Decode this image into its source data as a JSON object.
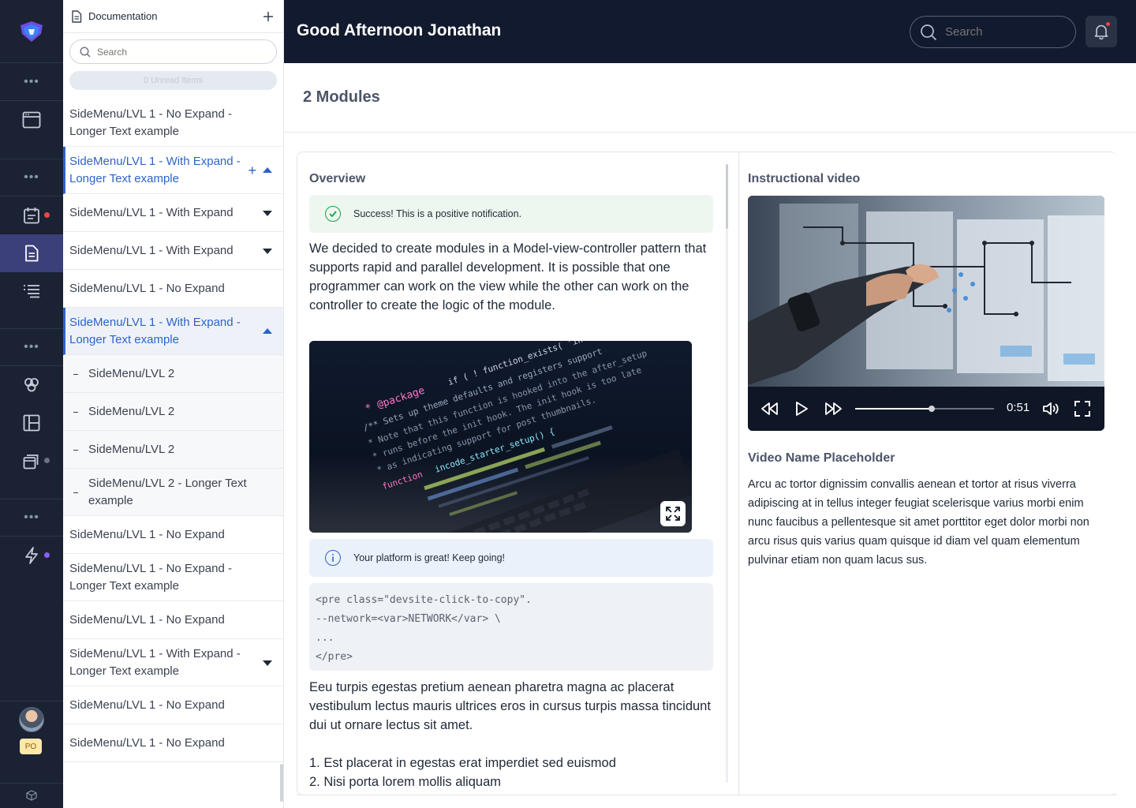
{
  "sidemenu": {
    "title": "Documentation",
    "search_placeholder": "Search",
    "unread": "0 Unread Items",
    "items": [
      {
        "label": "SideMenu/LVL 1 - No Expand - Longer Text example"
      },
      {
        "label": "SideMenu/LVL 1 - With Expand - Longer Text example"
      },
      {
        "label": "SideMenu/LVL 1 - With Expand"
      },
      {
        "label": "SideMenu/LVL 1 - With Expand"
      },
      {
        "label": "SideMenu/LVL 1 - No Expand"
      },
      {
        "label": "SideMenu/LVL 1 - With Expand - Longer Text example"
      },
      {
        "label": "SideMenu/LVL 2"
      },
      {
        "label": "SideMenu/LVL 2"
      },
      {
        "label": "SideMenu/LVL 2"
      },
      {
        "label": "SideMenu/LVL 2 - Longer Text example"
      },
      {
        "label": "SideMenu/LVL 1 - No Expand"
      },
      {
        "label": "SideMenu/LVL 1 - No Expand - Longer Text example"
      },
      {
        "label": "SideMenu/LVL 1 - No Expand"
      },
      {
        "label": "SideMenu/LVL 1 - With Expand - Longer Text example"
      },
      {
        "label": "SideMenu/LVL 1 - No Expand"
      },
      {
        "label": "SideMenu/LVL 1 - No Expand"
      }
    ]
  },
  "rail": {
    "user_badge": "PO",
    "icons": [
      "more-icon",
      "window-icon",
      "more-icon",
      "calendar-icon",
      "document-icon",
      "list-icon",
      "more-icon",
      "hexagons-icon",
      "layout-icon",
      "stack-icon",
      "more-icon",
      "bolt-icon",
      "cube-icon"
    ]
  },
  "topbar": {
    "greeting": "Good Afternoon Jonathan",
    "search_placeholder": "Search"
  },
  "page": {
    "title": "2 Modules"
  },
  "overview": {
    "heading": "Overview",
    "success_note": "Success! This is a positive notification.",
    "para1": "We decided to create modules in a Model-view-controller pattern that supports rapid and parallel development. It is possible that one programmer can work on the view while the other can work on the controller to create the logic of the module.",
    "info_note": "Your platform is great! Keep going!",
    "code": "<pre class=\"devsite-click-to-copy\".\n--network=<var>NETWORK</var> \\\n...\n</pre>",
    "para2": "Eeu turpis egestas pretium aenean pharetra magna ac placerat vestibulum lectus mauris ultrices eros in cursus turpis massa tincidunt dui ut ornare lectus sit amet.",
    "list": [
      "1. Est placerat in egestas erat imperdiet sed euismod",
      "2. Nisi porta lorem mollis aliquam"
    ]
  },
  "video": {
    "heading": "Instructional video",
    "time": "0:51",
    "progress": 0.55,
    "name": "Video Name Placeholder",
    "description": "Arcu ac tortor dignissim convallis aenean et tortor at risus viverra adipiscing at in tellus integer feugiat scelerisque varius morbi enim nunc faucibus a pellentesque sit amet porttitor eget dolor morbi non arcu risus quis varius quam quisque id diam vel quam elementum pulvinar etiam non quam lacus sus."
  },
  "colors": {
    "rail": "#1a2234",
    "topbar": "#111a2e",
    "accent": "#2d63c9",
    "success": "#16a34a",
    "danger": "#ef4444",
    "purple": "#8b5cf6"
  }
}
